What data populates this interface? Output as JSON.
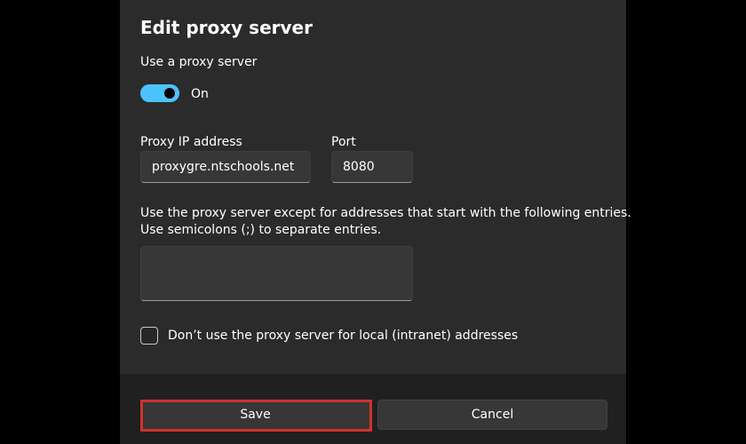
{
  "dialog": {
    "title": "Edit proxy server",
    "use_proxy_label": "Use a proxy server",
    "toggle_state": "On",
    "proxy_ip": {
      "label": "Proxy IP address",
      "value": "proxygre.ntschools.net"
    },
    "port": {
      "label": "Port",
      "value": "8080"
    },
    "exceptions": {
      "description_line1": "Use the proxy server except for addresses that start with the following entries.",
      "description_line2": "Use semicolons (;) to separate entries.",
      "value": ""
    },
    "local_checkbox": {
      "label": "Don’t use the proxy server for local (intranet) addresses",
      "checked": false
    },
    "buttons": {
      "save_label": "Save",
      "cancel_label": "Cancel"
    }
  },
  "colors": {
    "accent": "#4cc2ff",
    "highlight": "#d0312d",
    "dialog_bg": "#2b2b2b",
    "footer_bg": "#202020"
  }
}
